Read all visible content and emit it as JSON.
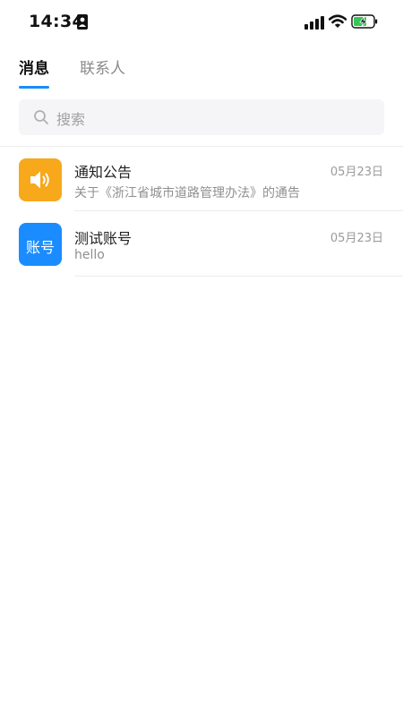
{
  "status_bar": {
    "time": "14:34",
    "icons": [
      "sim-icon",
      "signal-icon",
      "wifi-icon",
      "battery-charging-icon"
    ],
    "battery_color": "#34c759"
  },
  "tabs": [
    {
      "label": "消息",
      "active": true
    },
    {
      "label": "联系人",
      "active": false
    }
  ],
  "accent_color": "#1a8cff",
  "search": {
    "placeholder": "搜索"
  },
  "conversations": [
    {
      "title": "通知公告",
      "subtitle": "关于《浙江省城市道路管理办法》的通告",
      "date": "05月23日",
      "avatar_icon": "speaker-icon",
      "avatar_color": "#f7a81b"
    },
    {
      "title": "测试账号",
      "subtitle": "hello",
      "date": "05月23日",
      "avatar_text": "账号",
      "avatar_color": "#1a8cff"
    }
  ]
}
